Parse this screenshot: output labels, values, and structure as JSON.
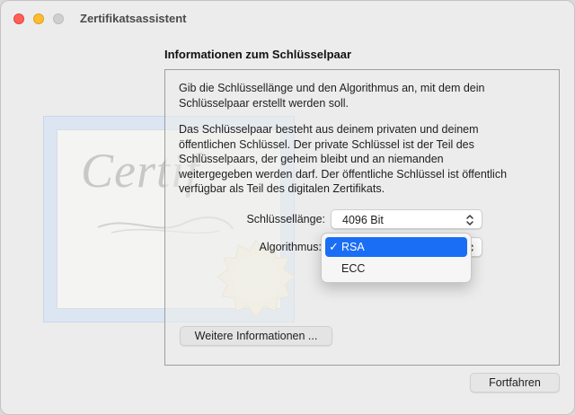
{
  "window": {
    "title": "Zertifikatsassistent"
  },
  "illustration": {
    "script_text": "Certif"
  },
  "section": {
    "title": "Informationen zum Schlüsselpaar",
    "paragraph1_line1": "Gib die Schlüssellänge und den Algorithmus an, mit dem dein",
    "paragraph1_line2": "Schlüsselpaar erstellt werden soll.",
    "paragraph2_line1": "Das Schlüsselpaar besteht aus deinem privaten und deinem",
    "paragraph2_line2": "öffentlichen Schlüssel. Der private Schlüssel ist der Teil des",
    "paragraph2_line3": "Schlüsselpaars, der geheim bleibt und an niemanden",
    "paragraph2_line4": "weitergegeben werden darf. Der öffentliche Schlüssel ist öffentlich",
    "paragraph2_line5": "verfügbar als Teil des digitalen Zertifikats."
  },
  "form": {
    "key_length_label": "Schlüssellänge:",
    "key_length_value": "4096 Bit",
    "algorithm_label": "Algorithmus:",
    "algorithm_value": "RSA"
  },
  "menu": {
    "check_glyph": "✓",
    "options": [
      "RSA",
      "ECC"
    ]
  },
  "buttons": {
    "more_info": "Weitere Informationen ...",
    "continue": "Fortfahren"
  },
  "colors": {
    "selection": "#1a6ef5",
    "close": "#ff5f57",
    "minimize": "#febc2e"
  }
}
